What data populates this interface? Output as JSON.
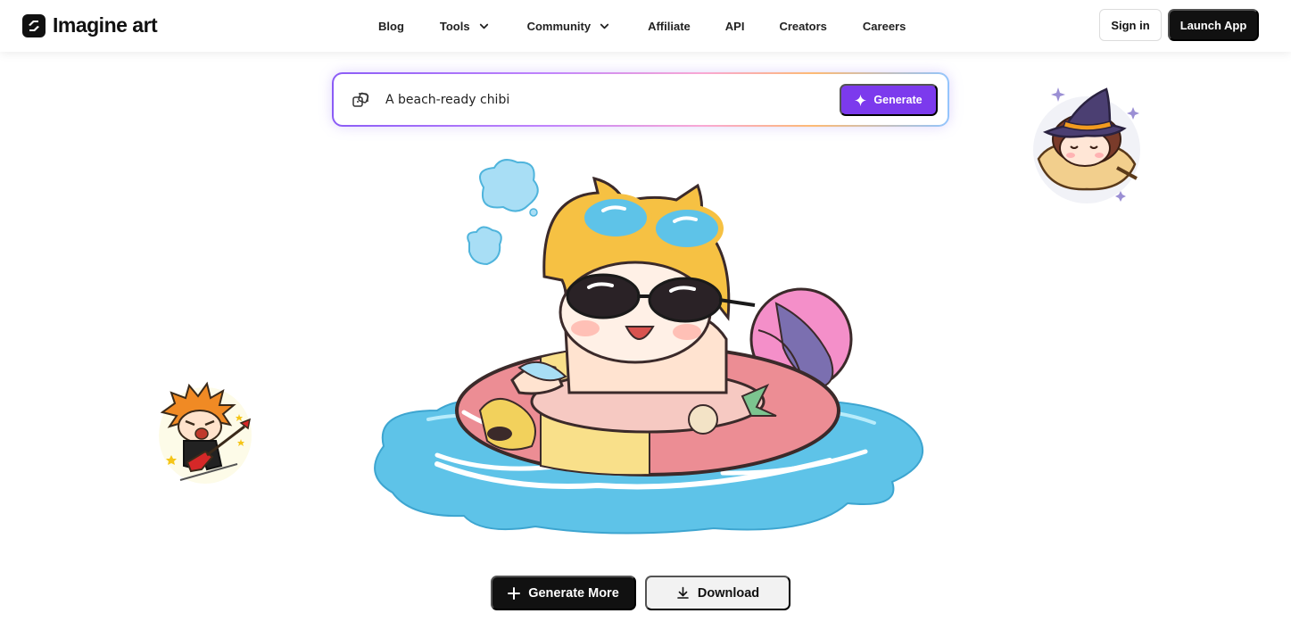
{
  "brand": {
    "name": "Imagine art",
    "logo_icon": "imagine-logo-icon"
  },
  "nav": {
    "links": [
      {
        "label": "Blog",
        "has_dropdown": false
      },
      {
        "label": "Tools",
        "has_dropdown": true
      },
      {
        "label": "Community",
        "has_dropdown": true
      },
      {
        "label": "Affiliate",
        "has_dropdown": false
      },
      {
        "label": "API",
        "has_dropdown": false
      },
      {
        "label": "Creators",
        "has_dropdown": false
      },
      {
        "label": "Careers",
        "has_dropdown": false
      }
    ],
    "sign_in": "Sign in",
    "launch_app": "Launch App"
  },
  "prompt": {
    "value": "A beach-ready chibi",
    "icon": "dice-icon",
    "generate_label": "Generate",
    "generate_icon": "sparkle-icon"
  },
  "actions": {
    "generate_more": "Generate More",
    "generate_more_icon": "plus-icon",
    "download": "Download",
    "download_icon": "download-icon"
  },
  "colors": {
    "accent": "#7c3aed",
    "dark": "#111111",
    "water": "#5ec3e8"
  }
}
